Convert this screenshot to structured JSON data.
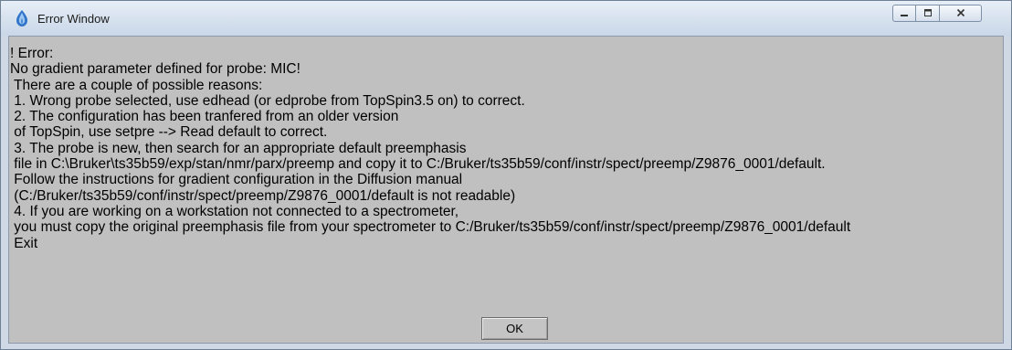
{
  "window": {
    "title": "Error Window",
    "icon": "topspin-app-icon",
    "controls": {
      "minimize_icon": "minimize-icon",
      "maximize_icon": "maximize-icon",
      "close_icon": "close-icon"
    }
  },
  "message": {
    "lines": [
      "! Error:",
      "No gradient parameter defined for probe: MIC!",
      " There are a couple of possible reasons:",
      " 1. Wrong probe selected, use edhead (or edprobe from TopSpin3.5 on) to correct.",
      " 2. The configuration has been tranfered from an older version",
      " of TopSpin, use setpre --> Read default to correct.",
      " 3. The probe is new, then search for an appropriate default preemphasis",
      " file in C:\\Bruker\\ts35b59/exp/stan/nmr/parx/preemp and copy it to C:/Bruker/ts35b59/conf/instr/spect/preemp/Z9876_0001/default.",
      " Follow the instructions for gradient configuration in the Diffusion manual",
      " (C:/Bruker/ts35b59/conf/instr/spect/preemp/Z9876_0001/default is not readable)",
      " 4. If you are working on a workstation not connected to a spectrometer,",
      " you must copy the original preemphasis file from your spectrometer to C:/Bruker/ts35b59/conf/instr/spect/preemp/Z9876_0001/default",
      " Exit"
    ]
  },
  "buttons": {
    "ok_label": "OK"
  },
  "colors": {
    "title_bar_top": "#e7eef7",
    "title_bar_bottom": "#c9d7e8",
    "dialog_background": "#c0c0c0",
    "text": "#000000"
  }
}
